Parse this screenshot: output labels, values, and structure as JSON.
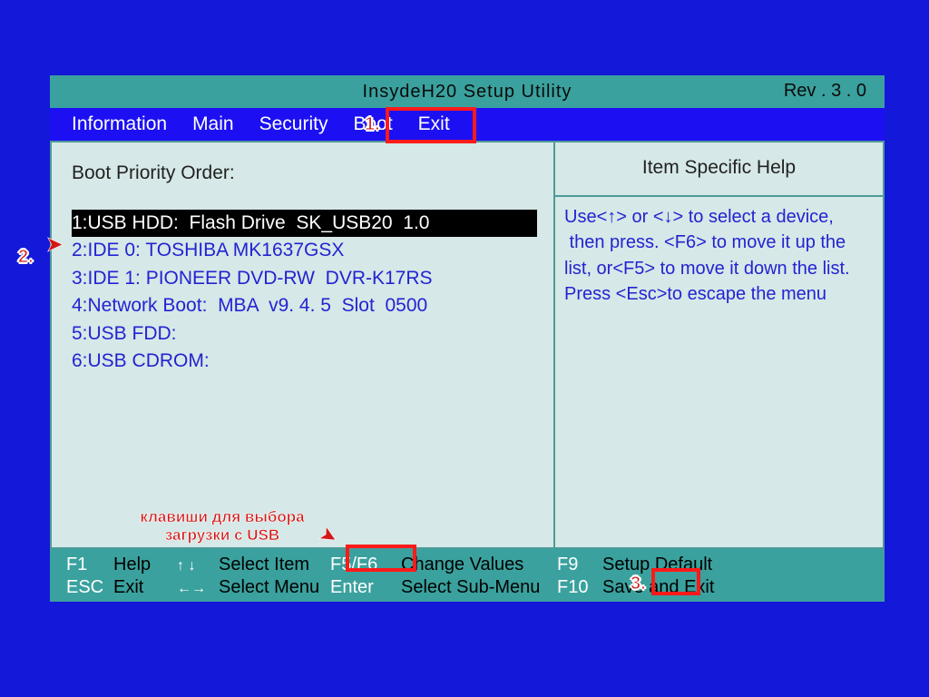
{
  "title": {
    "center": "InsydeH20  Setup  Utility",
    "rev": "Rev . 3 . 0"
  },
  "menu": {
    "items": [
      "Information",
      "Main",
      "Security",
      "Boot",
      "Exit"
    ],
    "selected_index": 3
  },
  "left": {
    "heading": "Boot Priority Order:",
    "boot": [
      "1:USB HDD:  Flash Drive  SK_USB20  1.0",
      "2:IDE 0: TOSHIBA MK1637GSX",
      "3:IDE 1: PIONEER DVD-RW  DVR-K17RS",
      "4:Network Boot:  MBA  v9. 4. 5  Slot  0500",
      "5:USB FDD:",
      "6:USB CDROM:"
    ],
    "selected_index": 0
  },
  "right": {
    "heading": "Item Specific Help",
    "body_html": "Use&lt;<span class='key'>↑</span>&gt; or &lt;<span class='key'>↓</span>&gt; to select a device,  then press. &lt;F6&gt; to move it up the list, or&lt;F5&gt; to move it down the list. Press &lt;Esc&gt;to escape the menu"
  },
  "footer": {
    "row1": {
      "k1": "F1",
      "a1": "Help",
      "arrows1": "↑↓",
      "a2": "Select Item",
      "k2": "F5/F6",
      "a3": "Change Values",
      "k3": "F9",
      "a4": "Setup Default"
    },
    "row2": {
      "k1": "ESC",
      "a1": "Exit",
      "arrows1": "↔↔",
      "a2": "Select Menu",
      "k2": "Enter",
      "a3": "Select  Sub-Menu",
      "k3": "F10",
      "a4": "Save and Exit"
    }
  },
  "annotations": {
    "label1": "1.",
    "label2": "2.",
    "label3": "3.",
    "caption": "клавиши для выбора\nзагрузки с USB"
  }
}
